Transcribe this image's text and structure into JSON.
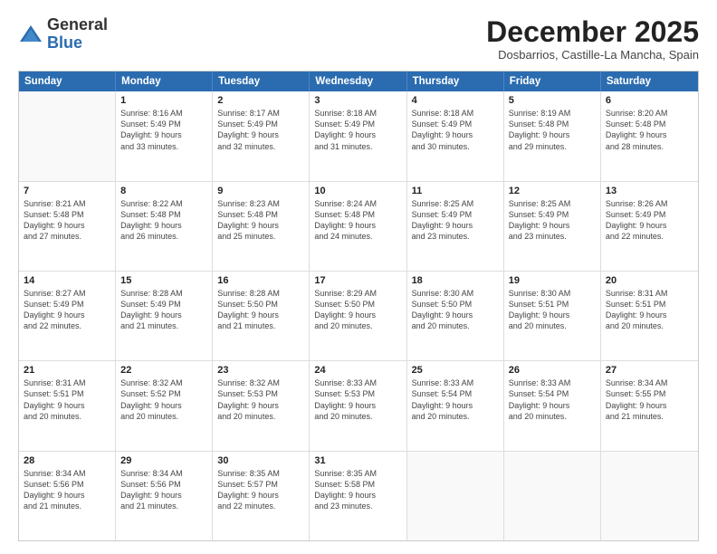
{
  "header": {
    "logo_general": "General",
    "logo_blue": "Blue",
    "month_title": "December 2025",
    "subtitle": "Dosbarrios, Castille-La Mancha, Spain"
  },
  "calendar": {
    "days_of_week": [
      "Sunday",
      "Monday",
      "Tuesday",
      "Wednesday",
      "Thursday",
      "Friday",
      "Saturday"
    ],
    "weeks": [
      [
        {
          "day": null,
          "lines": []
        },
        {
          "day": "1",
          "lines": [
            "Sunrise: 8:16 AM",
            "Sunset: 5:49 PM",
            "Daylight: 9 hours",
            "and 33 minutes."
          ]
        },
        {
          "day": "2",
          "lines": [
            "Sunrise: 8:17 AM",
            "Sunset: 5:49 PM",
            "Daylight: 9 hours",
            "and 32 minutes."
          ]
        },
        {
          "day": "3",
          "lines": [
            "Sunrise: 8:18 AM",
            "Sunset: 5:49 PM",
            "Daylight: 9 hours",
            "and 31 minutes."
          ]
        },
        {
          "day": "4",
          "lines": [
            "Sunrise: 8:18 AM",
            "Sunset: 5:49 PM",
            "Daylight: 9 hours",
            "and 30 minutes."
          ]
        },
        {
          "day": "5",
          "lines": [
            "Sunrise: 8:19 AM",
            "Sunset: 5:48 PM",
            "Daylight: 9 hours",
            "and 29 minutes."
          ]
        },
        {
          "day": "6",
          "lines": [
            "Sunrise: 8:20 AM",
            "Sunset: 5:48 PM",
            "Daylight: 9 hours",
            "and 28 minutes."
          ]
        }
      ],
      [
        {
          "day": "7",
          "lines": [
            "Sunrise: 8:21 AM",
            "Sunset: 5:48 PM",
            "Daylight: 9 hours",
            "and 27 minutes."
          ]
        },
        {
          "day": "8",
          "lines": [
            "Sunrise: 8:22 AM",
            "Sunset: 5:48 PM",
            "Daylight: 9 hours",
            "and 26 minutes."
          ]
        },
        {
          "day": "9",
          "lines": [
            "Sunrise: 8:23 AM",
            "Sunset: 5:48 PM",
            "Daylight: 9 hours",
            "and 25 minutes."
          ]
        },
        {
          "day": "10",
          "lines": [
            "Sunrise: 8:24 AM",
            "Sunset: 5:48 PM",
            "Daylight: 9 hours",
            "and 24 minutes."
          ]
        },
        {
          "day": "11",
          "lines": [
            "Sunrise: 8:25 AM",
            "Sunset: 5:49 PM",
            "Daylight: 9 hours",
            "and 23 minutes."
          ]
        },
        {
          "day": "12",
          "lines": [
            "Sunrise: 8:25 AM",
            "Sunset: 5:49 PM",
            "Daylight: 9 hours",
            "and 23 minutes."
          ]
        },
        {
          "day": "13",
          "lines": [
            "Sunrise: 8:26 AM",
            "Sunset: 5:49 PM",
            "Daylight: 9 hours",
            "and 22 minutes."
          ]
        }
      ],
      [
        {
          "day": "14",
          "lines": [
            "Sunrise: 8:27 AM",
            "Sunset: 5:49 PM",
            "Daylight: 9 hours",
            "and 22 minutes."
          ]
        },
        {
          "day": "15",
          "lines": [
            "Sunrise: 8:28 AM",
            "Sunset: 5:49 PM",
            "Daylight: 9 hours",
            "and 21 minutes."
          ]
        },
        {
          "day": "16",
          "lines": [
            "Sunrise: 8:28 AM",
            "Sunset: 5:50 PM",
            "Daylight: 9 hours",
            "and 21 minutes."
          ]
        },
        {
          "day": "17",
          "lines": [
            "Sunrise: 8:29 AM",
            "Sunset: 5:50 PM",
            "Daylight: 9 hours",
            "and 20 minutes."
          ]
        },
        {
          "day": "18",
          "lines": [
            "Sunrise: 8:30 AM",
            "Sunset: 5:50 PM",
            "Daylight: 9 hours",
            "and 20 minutes."
          ]
        },
        {
          "day": "19",
          "lines": [
            "Sunrise: 8:30 AM",
            "Sunset: 5:51 PM",
            "Daylight: 9 hours",
            "and 20 minutes."
          ]
        },
        {
          "day": "20",
          "lines": [
            "Sunrise: 8:31 AM",
            "Sunset: 5:51 PM",
            "Daylight: 9 hours",
            "and 20 minutes."
          ]
        }
      ],
      [
        {
          "day": "21",
          "lines": [
            "Sunrise: 8:31 AM",
            "Sunset: 5:51 PM",
            "Daylight: 9 hours",
            "and 20 minutes."
          ]
        },
        {
          "day": "22",
          "lines": [
            "Sunrise: 8:32 AM",
            "Sunset: 5:52 PM",
            "Daylight: 9 hours",
            "and 20 minutes."
          ]
        },
        {
          "day": "23",
          "lines": [
            "Sunrise: 8:32 AM",
            "Sunset: 5:53 PM",
            "Daylight: 9 hours",
            "and 20 minutes."
          ]
        },
        {
          "day": "24",
          "lines": [
            "Sunrise: 8:33 AM",
            "Sunset: 5:53 PM",
            "Daylight: 9 hours",
            "and 20 minutes."
          ]
        },
        {
          "day": "25",
          "lines": [
            "Sunrise: 8:33 AM",
            "Sunset: 5:54 PM",
            "Daylight: 9 hours",
            "and 20 minutes."
          ]
        },
        {
          "day": "26",
          "lines": [
            "Sunrise: 8:33 AM",
            "Sunset: 5:54 PM",
            "Daylight: 9 hours",
            "and 20 minutes."
          ]
        },
        {
          "day": "27",
          "lines": [
            "Sunrise: 8:34 AM",
            "Sunset: 5:55 PM",
            "Daylight: 9 hours",
            "and 21 minutes."
          ]
        }
      ],
      [
        {
          "day": "28",
          "lines": [
            "Sunrise: 8:34 AM",
            "Sunset: 5:56 PM",
            "Daylight: 9 hours",
            "and 21 minutes."
          ]
        },
        {
          "day": "29",
          "lines": [
            "Sunrise: 8:34 AM",
            "Sunset: 5:56 PM",
            "Daylight: 9 hours",
            "and 21 minutes."
          ]
        },
        {
          "day": "30",
          "lines": [
            "Sunrise: 8:35 AM",
            "Sunset: 5:57 PM",
            "Daylight: 9 hours",
            "and 22 minutes."
          ]
        },
        {
          "day": "31",
          "lines": [
            "Sunrise: 8:35 AM",
            "Sunset: 5:58 PM",
            "Daylight: 9 hours",
            "and 23 minutes."
          ]
        },
        {
          "day": null,
          "lines": []
        },
        {
          "day": null,
          "lines": []
        },
        {
          "day": null,
          "lines": []
        }
      ]
    ]
  }
}
